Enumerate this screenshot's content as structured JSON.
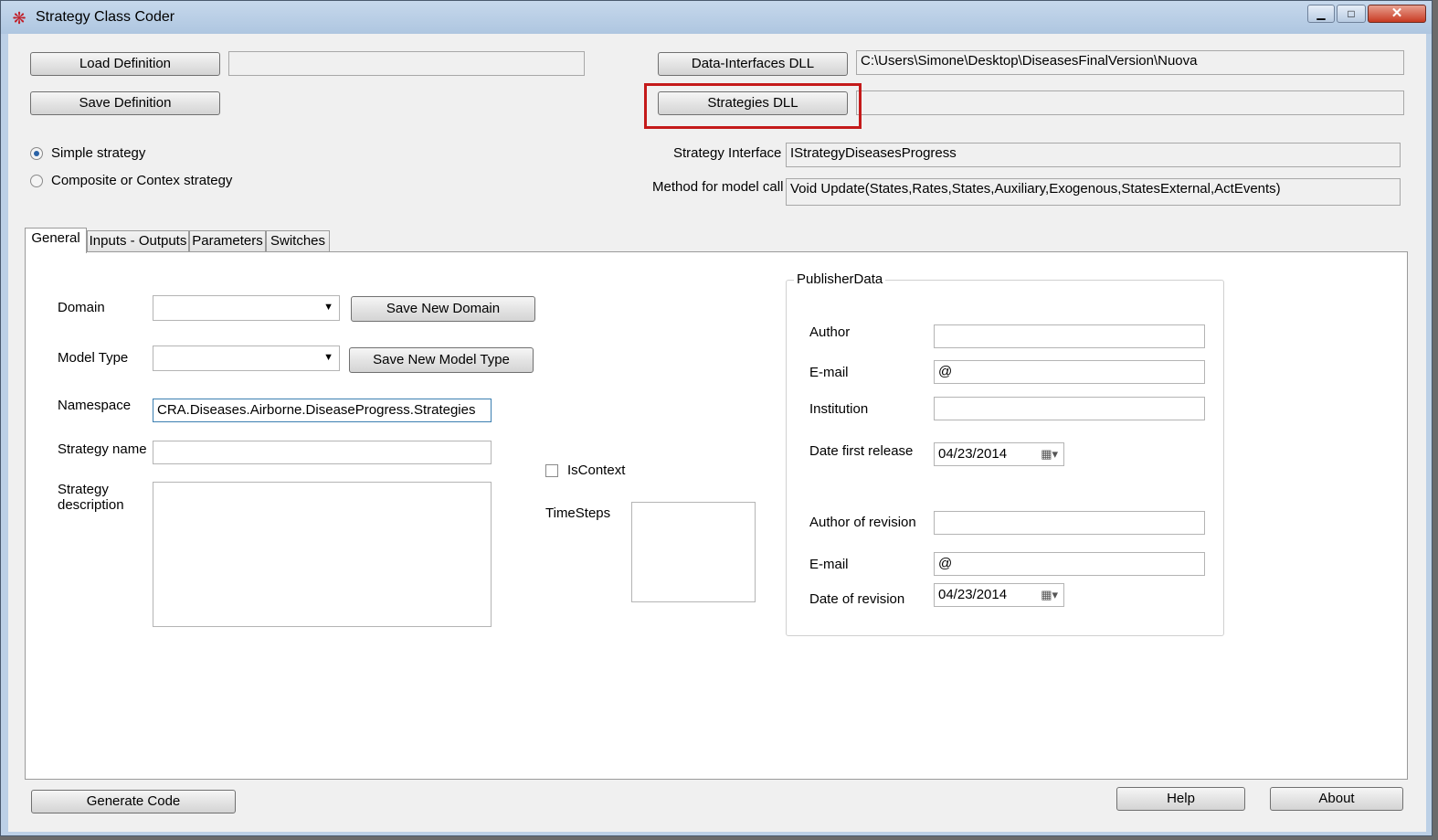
{
  "window": {
    "title": "Strategy Class Coder",
    "app_icon": "app-logo-icon",
    "controls": {
      "minimize": "▁",
      "maximize": "□",
      "close": "✕"
    }
  },
  "top": {
    "load_definition": "Load Definition",
    "load_path": "",
    "save_definition": "Save Definition",
    "data_interfaces_dll": "Data-Interfaces DLL",
    "data_interfaces_path": "C:\\Users\\Simone\\Desktop\\DiseasesFinalVersion\\Nuova",
    "strategies_dll": "Strategies DLL",
    "strategies_path": "",
    "simple_strategy": "Simple strategy",
    "composite_strategy": "Composite or Contex strategy",
    "strategy_interface_label": "Strategy Interface",
    "strategy_interface_value": "IStrategyDiseasesProgress",
    "method_label": "Method for model call",
    "method_value": "Void Update(States,Rates,States,Auxiliary,Exogenous,StatesExternal,ActEvents)"
  },
  "tabs": [
    "General",
    "Inputs - Outputs",
    "Parameters",
    "Switches"
  ],
  "general": {
    "domain_label": "Domain",
    "domain_value": "",
    "save_new_domain": "Save New Domain",
    "model_type_label": "Model Type",
    "model_type_value": "",
    "save_new_model_type": "Save New Model Type",
    "namespace_label": "Namespace",
    "namespace_value": "CRA.Diseases.Airborne.DiseaseProgress.Strategies",
    "strategy_name_label": "Strategy name",
    "strategy_name_value": "",
    "strategy_description_label_1": "Strategy",
    "strategy_description_label_2": "description",
    "iscontext_label": "IsContext",
    "timesteps_label": "TimeSteps"
  },
  "publisher": {
    "group_title": "PublisherData",
    "author_label": "Author",
    "author_value": "",
    "email_label": "E-mail",
    "email_value": "@",
    "institution_label": "Institution",
    "institution_value": "",
    "date_first_label": "Date first release",
    "date_first_value": "04/23/2014",
    "author_revision_label": "Author of revision",
    "author_revision_value": "",
    "email_revision_label": "E-mail",
    "email_revision_value": "@",
    "date_revision_label": "Date of revision",
    "date_revision_value": "04/23/2014"
  },
  "bottom": {
    "generate_code": "Generate Code",
    "help": "Help",
    "about": "About"
  },
  "colors": {
    "highlight": "#c41a1a",
    "window_frame": "#bcd0e6",
    "client_bg": "#f0f0f0"
  }
}
